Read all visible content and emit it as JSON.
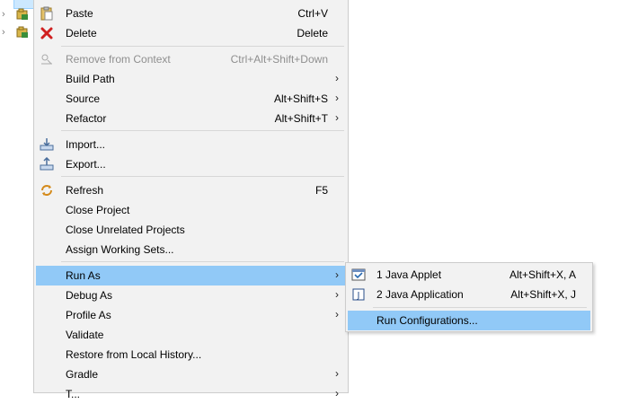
{
  "explorer": {
    "rows": [
      {
        "icon": "project-icon"
      },
      {
        "icon": "project-icon"
      },
      {
        "icon": "project-icon"
      }
    ]
  },
  "menu": {
    "paste": {
      "label": "Paste",
      "shortcut": "Ctrl+V"
    },
    "delete": {
      "label": "Delete",
      "shortcut": "Delete"
    },
    "remove_from_context": {
      "label": "Remove from Context",
      "shortcut": "Ctrl+Alt+Shift+Down"
    },
    "build_path": {
      "label": "Build Path"
    },
    "source": {
      "label": "Source",
      "shortcut": "Alt+Shift+S"
    },
    "refactor": {
      "label": "Refactor",
      "shortcut": "Alt+Shift+T"
    },
    "import": {
      "label": "Import..."
    },
    "export": {
      "label": "Export..."
    },
    "refresh": {
      "label": "Refresh",
      "shortcut": "F5"
    },
    "close_project": {
      "label": "Close Project"
    },
    "close_unrelated": {
      "label": "Close Unrelated Projects"
    },
    "assign_working_sets": {
      "label": "Assign Working Sets..."
    },
    "run_as": {
      "label": "Run As"
    },
    "debug_as": {
      "label": "Debug As"
    },
    "profile_as": {
      "label": "Profile As"
    },
    "validate": {
      "label": "Validate"
    },
    "restore_history": {
      "label": "Restore from Local History..."
    },
    "gradle": {
      "label": "Gradle"
    },
    "team": {
      "label": "T..."
    }
  },
  "submenu": {
    "java_applet": {
      "label": "1 Java Applet",
      "shortcut": "Alt+Shift+X, A"
    },
    "java_application": {
      "label": "2 Java Application",
      "shortcut": "Alt+Shift+X, J"
    },
    "run_configurations": {
      "label": "Run Configurations..."
    }
  },
  "colors": {
    "menu_bg": "#f2f2f2",
    "highlight": "#91c9f7",
    "disabled_text": "#8f8f8f"
  }
}
